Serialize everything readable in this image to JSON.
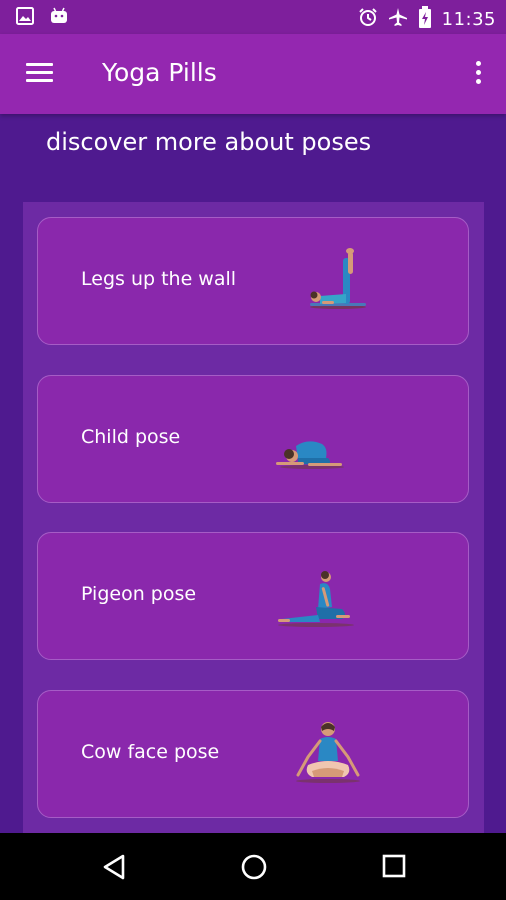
{
  "status_bar": {
    "time": "11:35",
    "left_icons": [
      "image-icon",
      "android-icon"
    ],
    "right_icons": [
      "alarm-icon",
      "airplane-icon",
      "battery-charging-icon"
    ]
  },
  "app_bar": {
    "title": "Yoga Pills",
    "menu_icon": "hamburger-menu-icon",
    "overflow_icon": "more-vert-icon"
  },
  "subtitle": "discover more about poses",
  "poses": [
    {
      "label": "Legs up the wall",
      "icon": "legs-up-the-wall-figure"
    },
    {
      "label": "Child pose",
      "icon": "child-pose-figure"
    },
    {
      "label": "Pigeon pose",
      "icon": "pigeon-pose-figure"
    },
    {
      "label": "Cow face pose",
      "icon": "cow-face-pose-figure"
    }
  ],
  "nav_bar": {
    "icons": [
      "back-icon",
      "home-icon",
      "recents-icon"
    ]
  },
  "colors": {
    "status_bar": "#7e1f9c",
    "app_bar": "#9427b0",
    "background": "#4f1a8f",
    "panel": "#6d2aa4",
    "card": "#8a28ac"
  }
}
